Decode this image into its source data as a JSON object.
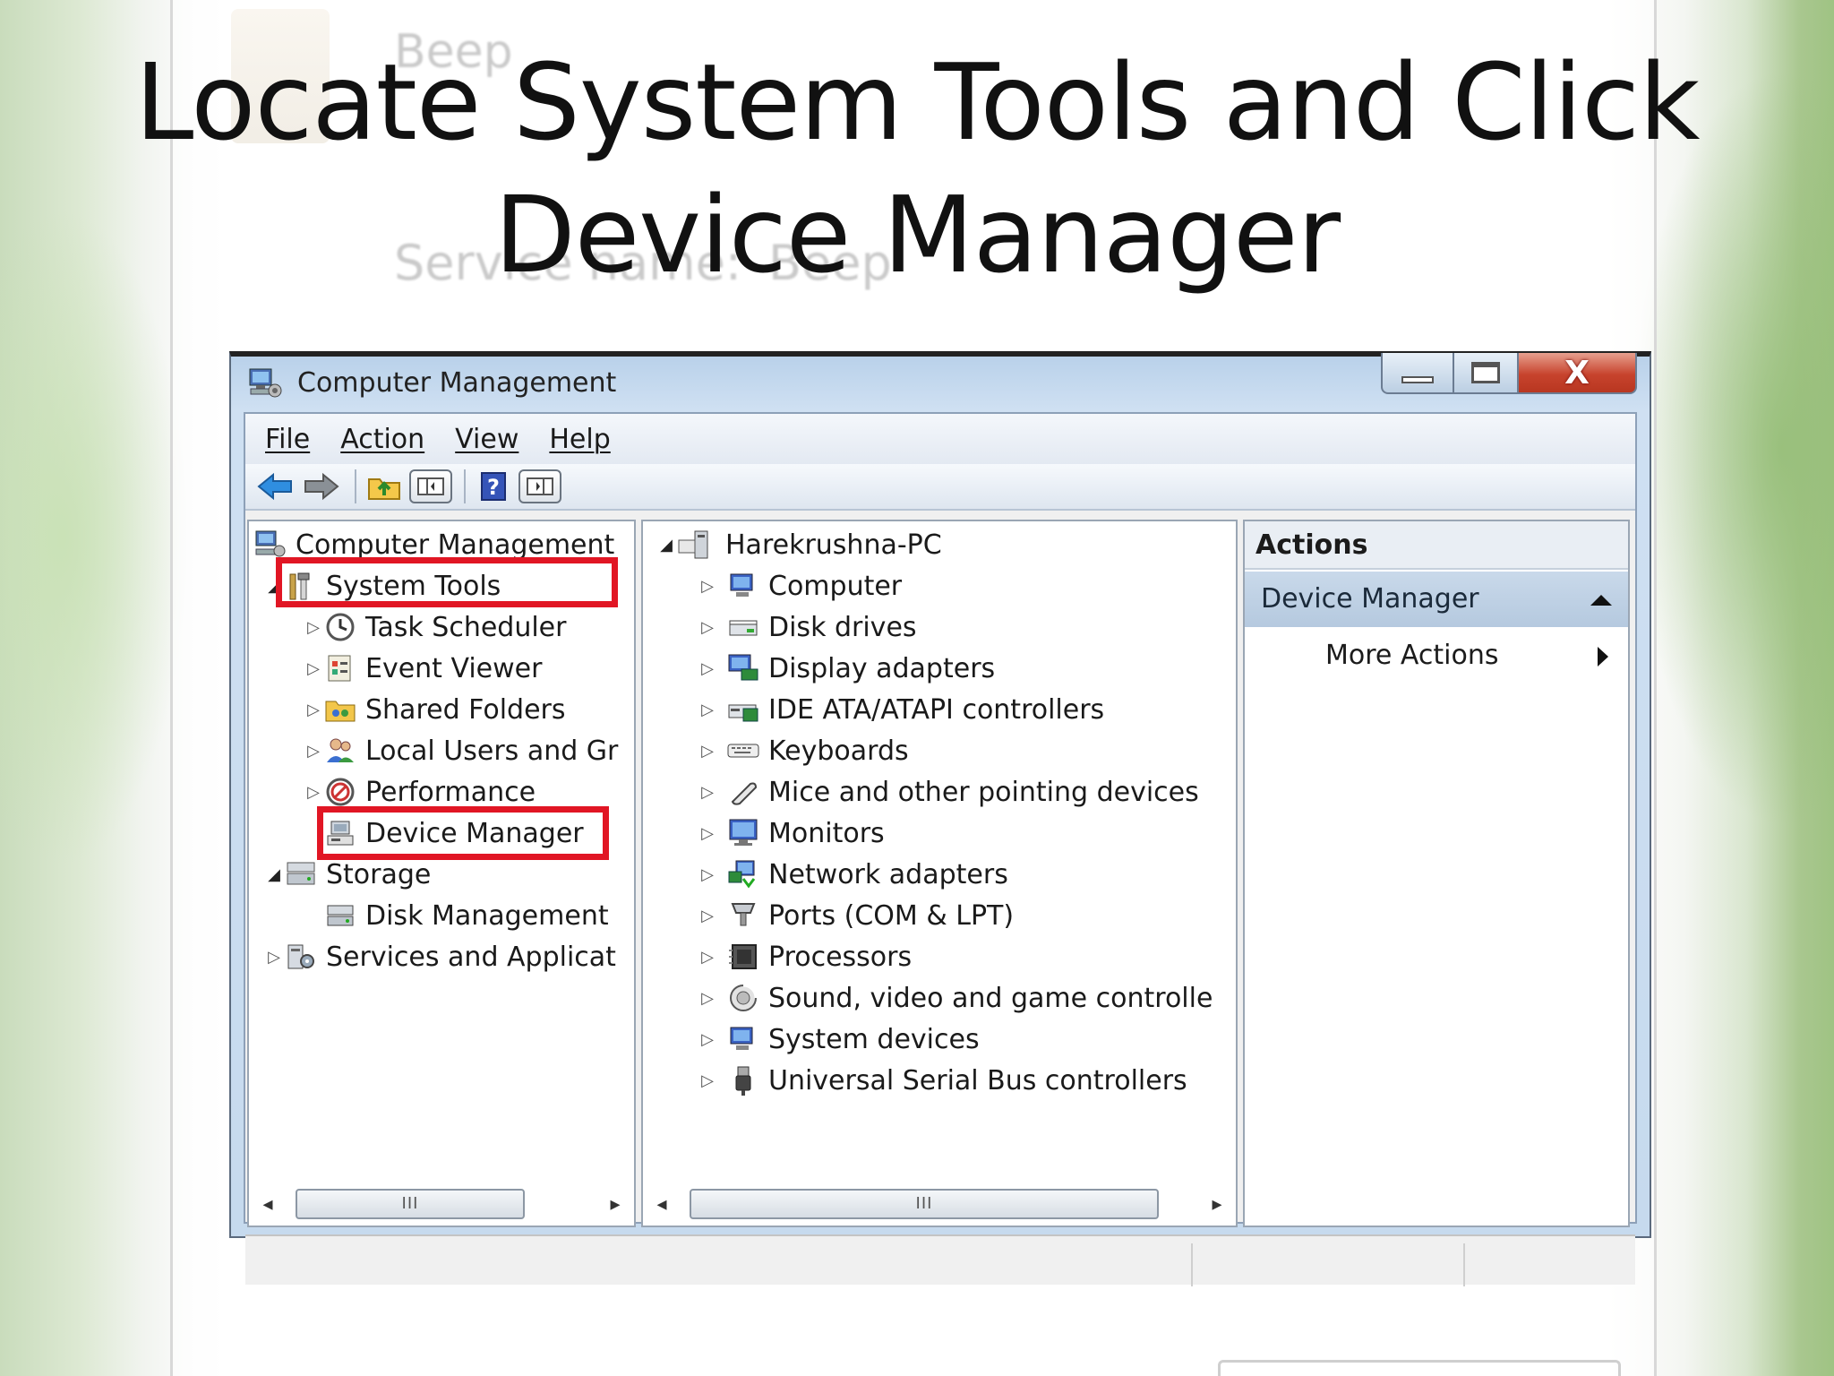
{
  "slide": {
    "title": "Locate System Tools and Click Device Manager",
    "background_ghost": {
      "beep_label": "Beep",
      "service_name_label": "Service name:",
      "service_name_value": "Beep"
    }
  },
  "window": {
    "title": "Computer Management",
    "close_glyph": "X",
    "menu": [
      "File",
      "Action",
      "View",
      "Help"
    ],
    "toolbar_icons": [
      "back-arrow-icon",
      "forward-arrow-icon",
      "up-folder-icon",
      "show-hide-tree-icon",
      "help-icon",
      "show-hide-action-pane-icon"
    ]
  },
  "tree": {
    "root": "Computer Management",
    "system_tools": "System Tools",
    "system_tools_children": [
      "Task Scheduler",
      "Event Viewer",
      "Shared Folders",
      "Local Users and Gr",
      "Performance",
      "Device Manager"
    ],
    "storage": "Storage",
    "storage_children": [
      "Disk Management"
    ],
    "services": "Services and Applicat",
    "scroll_thumb": "III"
  },
  "devices": {
    "computer_name": "Harekrushna-PC",
    "categories": [
      "Computer",
      "Disk drives",
      "Display adapters",
      "IDE ATA/ATAPI controllers",
      "Keyboards",
      "Mice and other pointing devices",
      "Monitors",
      "Network adapters",
      "Ports (COM & LPT)",
      "Processors",
      "Sound, video and game controlle",
      "System devices",
      "Universal Serial Bus controllers"
    ],
    "scroll_thumb": "III"
  },
  "actions": {
    "header": "Actions",
    "section": "Device Manager",
    "more": "More Actions"
  },
  "colors": {
    "highlight": "#e11624",
    "titlebar": "#b9d1ea",
    "close_button": "#c7432d"
  }
}
